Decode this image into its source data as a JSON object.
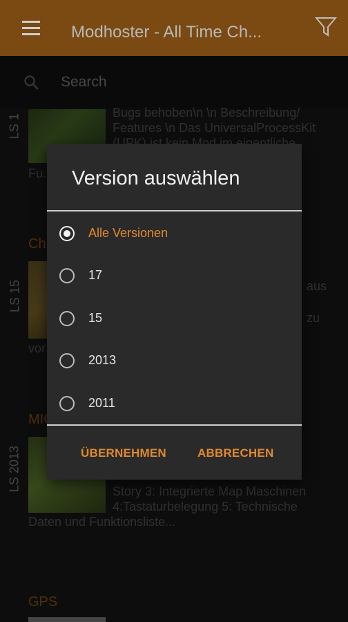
{
  "appbar": {
    "title": "Modhoster - All Time Ch...",
    "menu_icon": "menu-icon",
    "filter_icon": "filter-icon",
    "color": "#7a4a12"
  },
  "search": {
    "placeholder": "Search"
  },
  "list": {
    "items": [
      {
        "tab": "LS 1",
        "title": "",
        "desc": [
          "Bugs behoben\\n \\n Beschreibung/",
          "Features \\n Das UniversalProcessKit",
          "(UPK) ist kein Mod im eigentliche",
          "Fu...                                          um"
        ]
      },
      {
        "tab": "LS 15",
        "title": "Ch",
        "desc": [
          "aus",
          "zu",
          "vor"
        ]
      },
      {
        "tab": "LS 2013",
        "title": "MIC",
        "desc": [
          "Story 3: Integrierte Map Maschinen",
          "4:Tastaturbelegung 5: Technische",
          "Daten und Funktionsliste..."
        ]
      },
      {
        "tab": "",
        "title": "GPS",
        "desc": []
      }
    ]
  },
  "dialog": {
    "title": "Version auswählen",
    "options": [
      {
        "label": "Alle Versionen",
        "selected": true
      },
      {
        "label": "17",
        "selected": false
      },
      {
        "label": "15",
        "selected": false
      },
      {
        "label": "2013",
        "selected": false
      },
      {
        "label": "2011",
        "selected": false
      }
    ],
    "confirm_label": "ÜBERNEHMEN",
    "cancel_label": "ABBRECHEN",
    "accent": "#e08a2e"
  }
}
